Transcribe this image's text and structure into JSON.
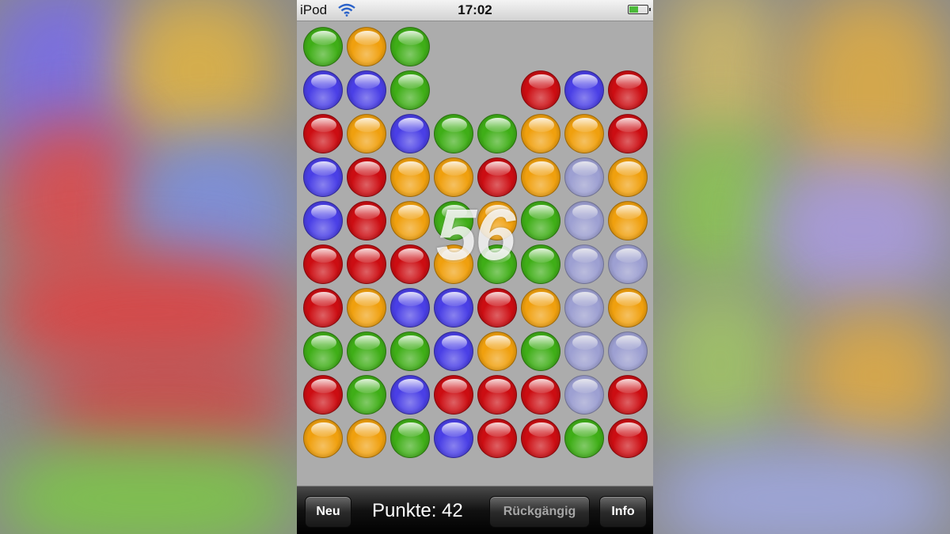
{
  "status_bar": {
    "carrier": "iPod",
    "wifi_icon": "wifi-icon",
    "time": "17:02",
    "battery_icon": "battery-icon",
    "battery_level": 0.5
  },
  "game": {
    "colors": {
      "green": "#3fae17",
      "orange": "#f0a00e",
      "blue": "#4a3fe6",
      "red": "#cc0d12",
      "empty": null
    },
    "selected_color": "#9b9ed9",
    "grid": [
      [
        "green",
        "orange",
        "green",
        null,
        null,
        null,
        null,
        null
      ],
      [
        "blue",
        "blue",
        "green",
        null,
        null,
        "red",
        "blue",
        "red"
      ],
      [
        "red",
        "orange",
        "blue",
        "green",
        "green",
        "orange",
        "orange",
        "red"
      ],
      [
        "blue",
        "red",
        "orange",
        "orange",
        "red",
        "orange",
        "sel",
        "orange"
      ],
      [
        "blue",
        "red",
        "orange",
        "green",
        "orange",
        "green",
        "sel",
        "orange"
      ],
      [
        "red",
        "red",
        "red",
        "orange",
        "green",
        "green",
        "sel",
        "sel"
      ],
      [
        "red",
        "orange",
        "blue",
        "blue",
        "red",
        "orange",
        "sel",
        "orange"
      ],
      [
        "green",
        "green",
        "green",
        "blue",
        "orange",
        "green",
        "sel",
        "sel"
      ],
      [
        "red",
        "green",
        "blue",
        "red",
        "red",
        "red",
        "sel",
        "red"
      ],
      [
        "orange",
        "orange",
        "green",
        "blue",
        "red",
        "red",
        "green",
        "red"
      ]
    ],
    "selection_score": "56"
  },
  "toolbar": {
    "new_label": "Neu",
    "points_label": "Punkte: 42",
    "undo_label": "Rückgängig",
    "info_label": "Info"
  }
}
